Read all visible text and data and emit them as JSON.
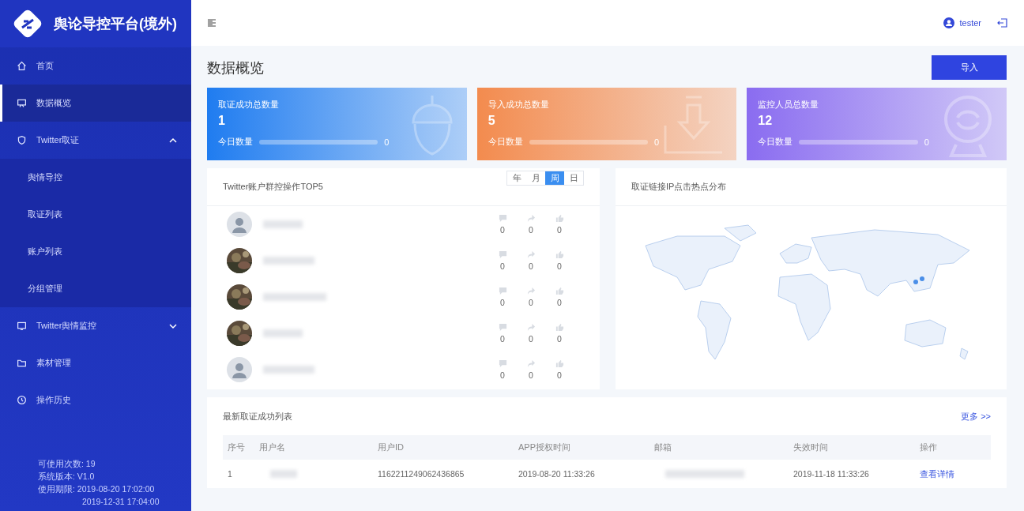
{
  "brand": {
    "title": "舆论导控平台(境外)"
  },
  "menu": [
    {
      "label": "首页",
      "kind": "home",
      "selected": false
    },
    {
      "label": "数据概览",
      "kind": "board",
      "selected": true
    },
    {
      "label": "Twitter取证",
      "kind": "shield",
      "expanded": true,
      "children": [
        {
          "label": "舆情导控"
        },
        {
          "label": "取证列表"
        },
        {
          "label": "账户列表"
        },
        {
          "label": "分组管理"
        }
      ]
    },
    {
      "label": "Twitter舆情监控",
      "kind": "monitor",
      "expanded": false
    },
    {
      "label": "素材管理",
      "kind": "folder",
      "selected": false
    },
    {
      "label": "操作历史",
      "kind": "clock",
      "selected": false
    }
  ],
  "sidebar_info": [
    "可使用次数: 19",
    "系统版本: V1.0",
    "使用期限: 2019-08-20 17:02:00",
    "2019-12-31 17:04:00"
  ],
  "header": {
    "user": "tester"
  },
  "page_title": "数据概览",
  "import_button": "导入",
  "stats": [
    {
      "label": "取证成功总数量",
      "value": "1",
      "today_label": "今日数量",
      "today": "0",
      "level": 0,
      "color": "#1f7cf0",
      "kind": "acorn"
    },
    {
      "label": "导入成功总数量",
      "value": "5",
      "today_label": "今日数量",
      "today": "0",
      "level": 0,
      "color": "#f38b4e",
      "kind": "download"
    },
    {
      "label": "监控人员总数量",
      "value": "12",
      "today_label": "今日数量",
      "today": "0",
      "level": 0,
      "color": "#8a6cf0",
      "kind": "camera"
    }
  ],
  "top5": {
    "title": "Twitter账户群控操作TOP5",
    "periods": [
      {
        "label": "年",
        "selected": false
      },
      {
        "label": "月",
        "selected": false
      },
      {
        "label": "周",
        "selected": true
      },
      {
        "label": "日",
        "selected": false
      }
    ],
    "rows": [
      {
        "kind": "default",
        "comments": "0",
        "shares": "0",
        "likes": "0"
      },
      {
        "kind": "picture",
        "comments": "0",
        "shares": "0",
        "likes": "0"
      },
      {
        "kind": "picture",
        "comments": "0",
        "shares": "0",
        "likes": "0"
      },
      {
        "kind": "picture",
        "comments": "0",
        "shares": "0",
        "likes": "0"
      },
      {
        "kind": "default",
        "comments": "0",
        "shares": "0",
        "likes": "0"
      }
    ]
  },
  "map": {
    "title": "取证链接IP点击热点分布"
  },
  "latest": {
    "title": "最新取证成功列表",
    "more": "更多 >>",
    "columns": [
      "序号",
      "用户名",
      "用户ID",
      "APP授权时间",
      "邮箱",
      "失效时间",
      "操作"
    ],
    "rows": [
      {
        "index": "1",
        "user_id": "1162211249062436865",
        "auth_time": "2019-08-20 11:33:26",
        "expire_time": "2019-11-18 11:33:26",
        "action": "查看详情"
      }
    ]
  }
}
